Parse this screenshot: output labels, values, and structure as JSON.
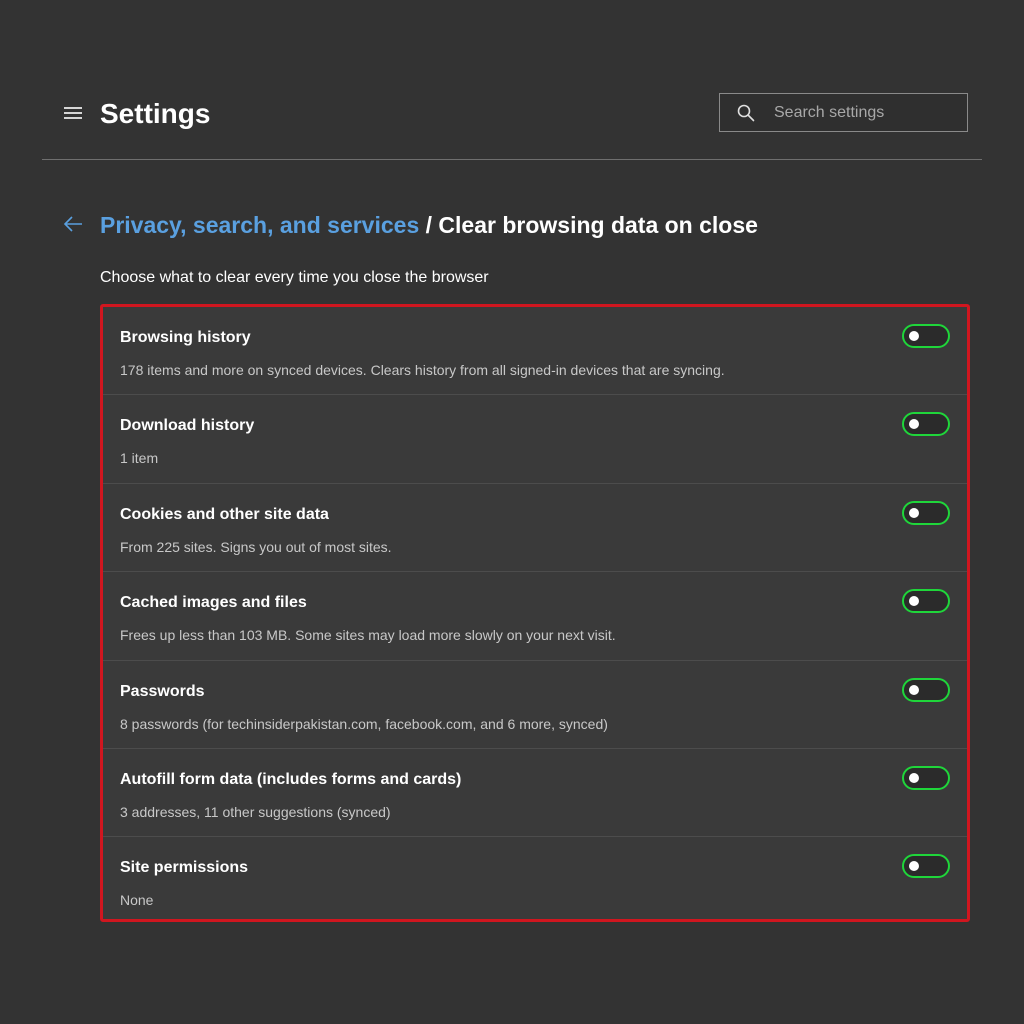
{
  "header": {
    "title": "Settings",
    "search": {
      "placeholder": "Search settings",
      "value": ""
    }
  },
  "breadcrumb": {
    "parent": "Privacy, search, and services",
    "separator": " / ",
    "current": "Clear browsing data on close"
  },
  "subtitle": "Choose what to clear every time you close the browser",
  "options": [
    {
      "title": "Browsing history",
      "description": "178 items and more on synced devices. Clears history from all signed-in devices that are syncing.",
      "enabled": false
    },
    {
      "title": "Download history",
      "description": "1 item",
      "enabled": false
    },
    {
      "title": "Cookies and other site data",
      "description": "From 225 sites. Signs you out of most sites.",
      "enabled": false
    },
    {
      "title": "Cached images and files",
      "description": "Frees up less than 103 MB. Some sites may load more slowly on your next visit.",
      "enabled": false
    },
    {
      "title": "Passwords",
      "description": "8 passwords (for techinsiderpakistan.com, facebook.com, and 6 more, synced)",
      "enabled": false
    },
    {
      "title": "Autofill form data (includes forms and cards)",
      "description": "3 addresses, 11 other suggestions (synced)",
      "enabled": false
    },
    {
      "title": "Site permissions",
      "description": "None",
      "enabled": false
    }
  ],
  "colors": {
    "background": "#333333",
    "link": "#5aa0e0",
    "highlight_border": "#d0161f",
    "toggle_outline": "#1fd63a"
  },
  "icons": {
    "menu": "hamburger-menu-icon",
    "search": "search-icon",
    "back": "back-arrow-icon"
  }
}
